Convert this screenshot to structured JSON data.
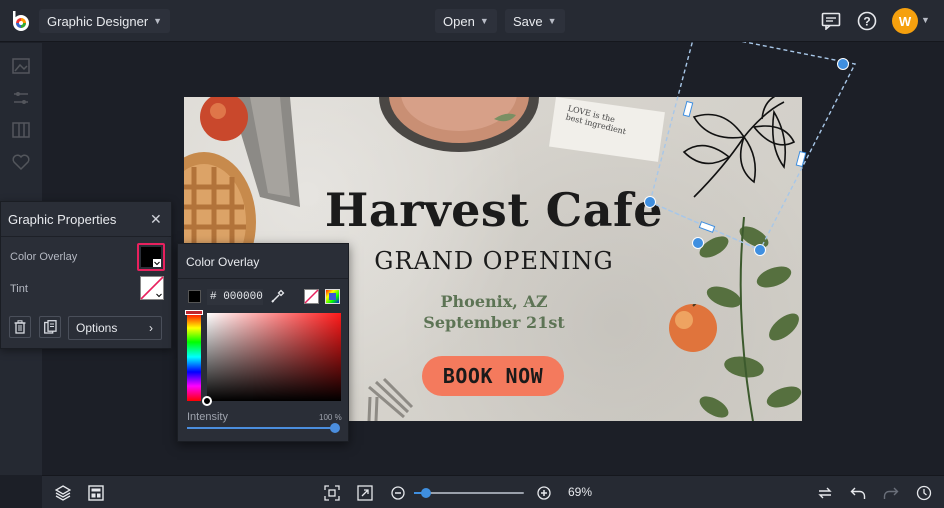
{
  "app": {
    "title": "Graphic Designer",
    "menu_open": "Open",
    "menu_save": "Save",
    "avatar_initial": "W"
  },
  "graphic_properties": {
    "title": "Graphic Properties",
    "color_overlay_label": "Color Overlay",
    "tint_label": "Tint",
    "options_label": "Options"
  },
  "color_overlay": {
    "title": "Color Overlay",
    "hex_value": "# 000000",
    "intensity_label": "Intensity",
    "intensity_value": "100 %",
    "intensity_fraction": 1.0
  },
  "design": {
    "title": "Harvest Cafe",
    "subtitle": "GRAND OPENING",
    "city": "Phoenix, AZ",
    "date": "September 21st",
    "cta": "BOOK NOW",
    "napkin_line1": "LOVE is the",
    "napkin_line2": "best ingredient"
  },
  "zoom": {
    "label": "69%",
    "fraction": 0.11
  },
  "colors": {
    "accent": "#3f8fe0",
    "highlight": "#e8215e",
    "cta": "#f47a5d",
    "avatar": "#f5a00e"
  }
}
